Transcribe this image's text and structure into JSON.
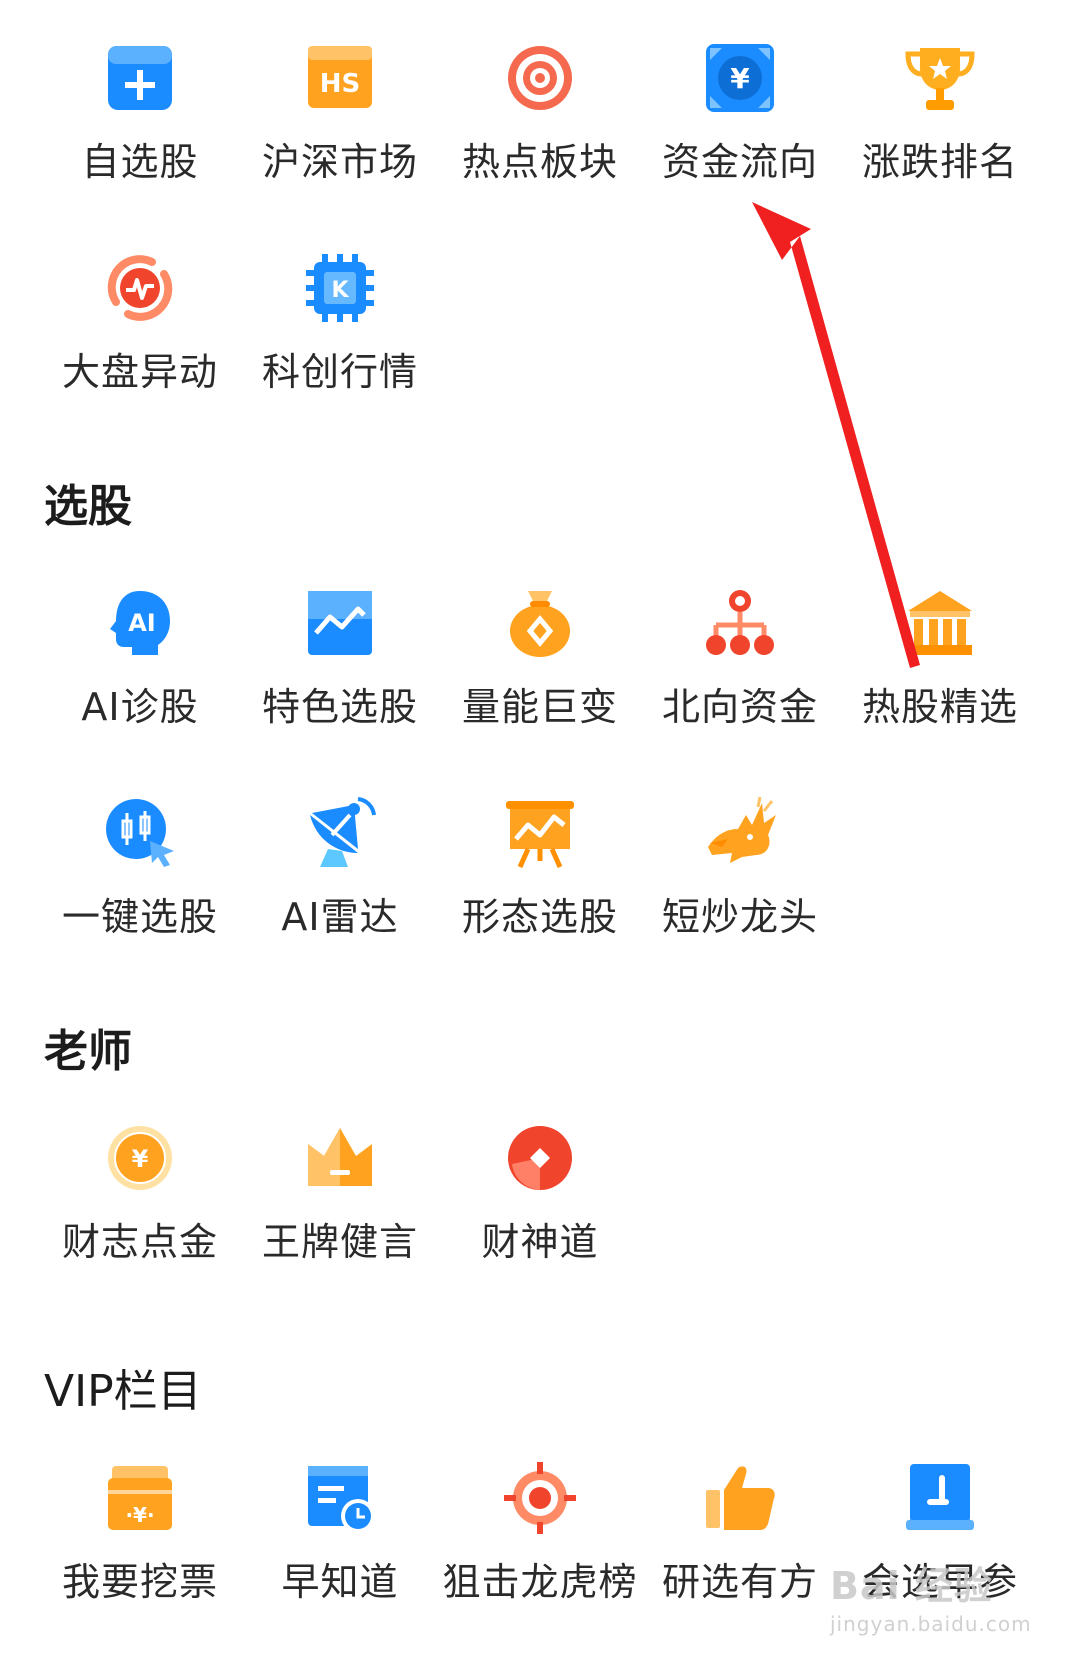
{
  "market": {
    "items": [
      {
        "label": "自选股",
        "icon": "add-folder-icon"
      },
      {
        "label": "沪深市场",
        "icon": "hs-market-icon"
      },
      {
        "label": "热点板块",
        "icon": "target-icon"
      },
      {
        "label": "资金流向",
        "icon": "yuan-flow-icon"
      },
      {
        "label": "涨跌排名",
        "icon": "trophy-icon"
      },
      {
        "label": "大盘异动",
        "icon": "pulse-icon"
      },
      {
        "label": "科创行情",
        "icon": "chip-icon"
      }
    ]
  },
  "stock_pick": {
    "title": "选股",
    "items": [
      {
        "label": "AI诊股",
        "icon": "ai-head-icon"
      },
      {
        "label": "特色选股",
        "icon": "chart-board-icon"
      },
      {
        "label": "量能巨变",
        "icon": "money-bag-icon"
      },
      {
        "label": "北向资金",
        "icon": "org-tree-icon"
      },
      {
        "label": "热股精选",
        "icon": "bank-building-icon"
      },
      {
        "label": "一键选股",
        "icon": "click-candle-icon"
      },
      {
        "label": "AI雷达",
        "icon": "satellite-dish-icon"
      },
      {
        "label": "形态选股",
        "icon": "easel-chart-icon"
      },
      {
        "label": "短炒龙头",
        "icon": "dragon-icon"
      }
    ]
  },
  "teacher": {
    "title": "老师",
    "items": [
      {
        "label": "财志点金",
        "icon": "gold-coin-icon"
      },
      {
        "label": "王牌健言",
        "icon": "crown-icon"
      },
      {
        "label": "财神道",
        "icon": "red-diamond-icon"
      }
    ]
  },
  "vip": {
    "title": "VIP栏目",
    "items": [
      {
        "label": "我要挖票",
        "icon": "wallet-yuan-icon"
      },
      {
        "label": "早知道",
        "icon": "calendar-clock-icon"
      },
      {
        "label": "狙击龙虎榜",
        "icon": "crosshair-icon"
      },
      {
        "label": "研选有方",
        "icon": "thumbs-up-icon"
      },
      {
        "label": "会选早参",
        "icon": "calendar-down-icon"
      }
    ]
  },
  "watermark": {
    "main": "Bai 经验",
    "sub": "jingyan.baidu.com"
  },
  "colors": {
    "blue": "#1a8cff",
    "orange": "#ffa21f",
    "red": "#f0442c",
    "arrow": "#f02020"
  }
}
